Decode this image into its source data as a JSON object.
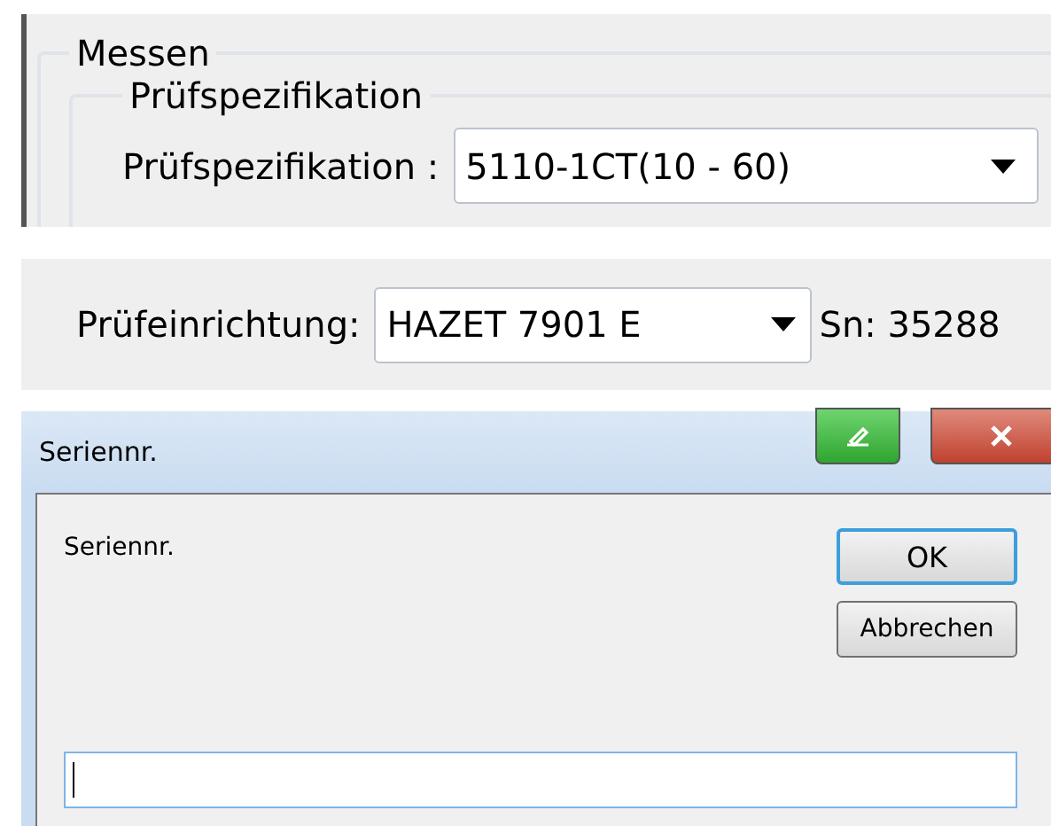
{
  "measure": {
    "title": "Messen",
    "subgroup": {
      "title": "Prüfspezifikation",
      "field": {
        "label": "Prüfspezifikation :",
        "value": "5110-1CT(10 - 60)"
      }
    }
  },
  "device": {
    "label": "Prüfeinrichtung:",
    "value": "HAZET 7901 E",
    "serial": "Sn: 35288"
  },
  "dialog": {
    "title": "Seriennr.",
    "prompt": "Seriennr.",
    "buttons": [
      {
        "label": "OK",
        "default": true
      },
      {
        "label": "Abbrechen",
        "default": false
      }
    ]
  }
}
